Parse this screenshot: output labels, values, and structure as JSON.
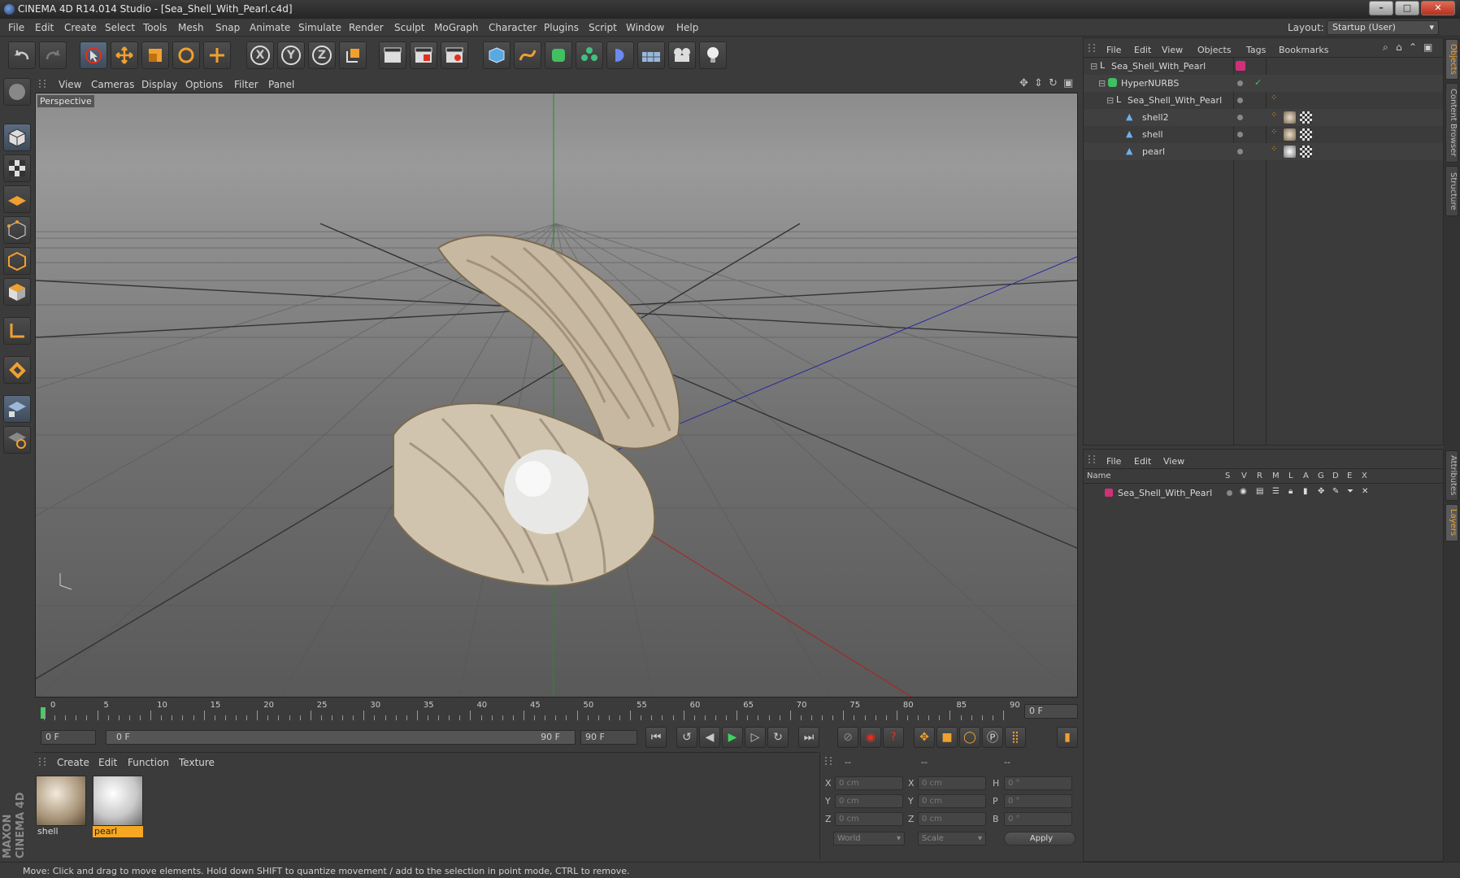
{
  "window": {
    "title": "CINEMA 4D R14.014 Studio - [Sea_Shell_With_Pearl.c4d]",
    "controls": [
      "–",
      "□",
      "✕"
    ]
  },
  "menu": [
    "File",
    "Edit",
    "Create",
    "Select",
    "Tools",
    "Mesh",
    "Snap",
    "Animate",
    "Simulate",
    "Render",
    "Sculpt",
    "MoGraph",
    "Character",
    "Plugins",
    "Script",
    "Window",
    "Help"
  ],
  "layout": {
    "label": "Layout:",
    "value": "Startup (User)"
  },
  "toolbar": {
    "axis_x": "X",
    "axis_y": "Y",
    "axis_z": "Z"
  },
  "viewport": {
    "menu": [
      "View",
      "Cameras",
      "Display",
      "Options",
      "Filter",
      "Panel"
    ],
    "label": "Perspective"
  },
  "timeline": {
    "ticks": [
      "0",
      "5",
      "10",
      "15",
      "20",
      "25",
      "30",
      "35",
      "40",
      "45",
      "50",
      "55",
      "60",
      "65",
      "70",
      "75",
      "80",
      "85",
      "90"
    ],
    "current_frame": "0 F"
  },
  "transport": {
    "start": "0 F",
    "range_start": "0 F",
    "range_end": "90 F",
    "end": "90 F"
  },
  "materials": {
    "menu": [
      "Create",
      "Edit",
      "Function",
      "Texture"
    ],
    "items": [
      "shell",
      "pearl"
    ]
  },
  "coords": {
    "headers": [
      "--",
      "--",
      "--"
    ],
    "rows": [
      {
        "a": "X",
        "pos": "0 cm",
        "b": "X",
        "size": "0 cm",
        "c": "H",
        "rot": "0 °"
      },
      {
        "a": "Y",
        "pos": "0 cm",
        "b": "Y",
        "size": "0 cm",
        "c": "P",
        "rot": "0 °"
      },
      {
        "a": "Z",
        "pos": "0 cm",
        "b": "Z",
        "size": "0 cm",
        "c": "B",
        "rot": "0 °"
      }
    ],
    "mode": "World",
    "scale": "Scale",
    "apply": "Apply"
  },
  "objects": {
    "menu": [
      "File",
      "Edit",
      "View",
      "Objects",
      "Tags",
      "Bookmarks"
    ],
    "tree": [
      "Sea_Shell_With_Pearl",
      "HyperNURBS",
      "Sea_Shell_With_Pearl",
      "shell2",
      "shell",
      "pearl"
    ]
  },
  "layers": {
    "menu": [
      "File",
      "Edit",
      "View"
    ],
    "columns": [
      "Name",
      "S",
      "V",
      "R",
      "M",
      "L",
      "A",
      "G",
      "D",
      "E",
      "X"
    ],
    "rows": [
      "Sea_Shell_With_Pearl"
    ]
  },
  "side_tabs": [
    "Objects",
    "Content Browser",
    "Structure",
    "Attributes",
    "Layers"
  ],
  "brand": "MAXON CINEMA 4D",
  "status": "Move: Click and drag to move elements. Hold down SHIFT to quantize movement / add to the selection in point mode, CTRL to remove.",
  "colors": {
    "accent": "#f0a030",
    "layer": "#d0307a",
    "selected": "#f5a623"
  }
}
